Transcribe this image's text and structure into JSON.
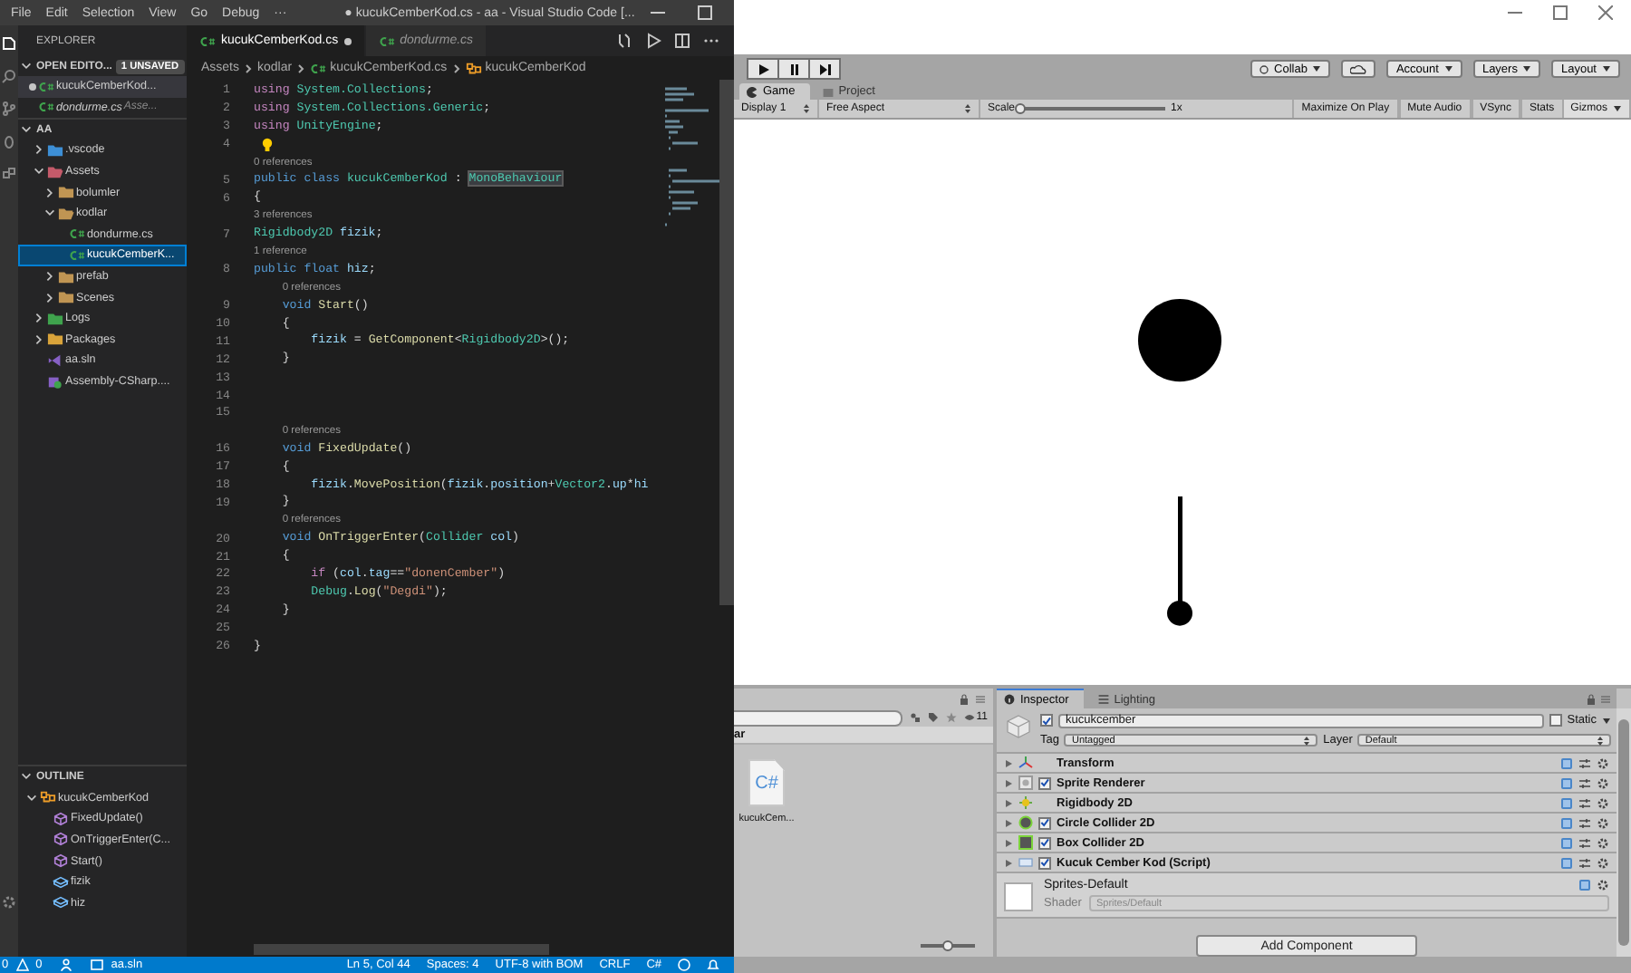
{
  "vscode": {
    "menu": [
      "File",
      "Edit",
      "Selection",
      "View",
      "Go",
      "Debug",
      "···"
    ],
    "title": "● kucukCemberKod.cs - aa - Visual Studio Code [...",
    "explorer": {
      "title": "EXPLORER",
      "open_editors": {
        "label": "OPEN EDITO...",
        "badge": "1 UNSAVED",
        "expanded": true,
        "items": [
          {
            "name": "kucukCemberKod...",
            "kind": "csharp",
            "dirty": true,
            "preview": false,
            "selected": true
          },
          {
            "name": "dondurme.cs",
            "description": "Asse...",
            "kind": "csharp",
            "dirty": false,
            "preview": true,
            "selected": false
          }
        ]
      },
      "folder": {
        "label": "AA",
        "expanded": true,
        "children": [
          {
            "label": ".vscode",
            "kind": "folder",
            "color": "#3d8fd6",
            "expanded": false,
            "selected": false
          },
          {
            "label": "Assets",
            "kind": "folder",
            "color": "#c55a6a",
            "expanded": true,
            "selected": false,
            "children": [
              {
                "label": "bolumler",
                "kind": "folder",
                "color": "#c09553",
                "expanded": false,
                "selected": false
              },
              {
                "label": "kodlar",
                "kind": "folder",
                "color": "#c09553",
                "expanded": true,
                "selected": false,
                "children": [
                  {
                    "label": "dondurme.cs",
                    "kind": "csharp",
                    "selected": false
                  },
                  {
                    "label": "kucukCemberK...",
                    "kind": "csharp",
                    "selected": true
                  }
                ]
              },
              {
                "label": "prefab",
                "kind": "folder",
                "color": "#c09553",
                "expanded": false,
                "selected": false
              },
              {
                "label": "Scenes",
                "kind": "folder",
                "color": "#c09553",
                "expanded": false,
                "selected": false
              }
            ]
          },
          {
            "label": "Logs",
            "kind": "folder",
            "color": "#3fa34d",
            "expanded": false,
            "selected": false
          },
          {
            "label": "Packages",
            "kind": "folder",
            "color": "#d9a33a",
            "expanded": false,
            "selected": false
          },
          {
            "label": "aa.sln",
            "kind": "solution",
            "selected": false
          },
          {
            "label": "Assembly-CSharp....",
            "kind": "project",
            "selected": false
          }
        ]
      },
      "outline": {
        "label": "OUTLINE",
        "expanded": true,
        "children": [
          {
            "label": "kucukCemberKod",
            "kind": "class",
            "expanded": true,
            "children": [
              {
                "label": "FixedUpdate()",
                "kind": "method"
              },
              {
                "label": "OnTriggerEnter(C...",
                "kind": "method"
              },
              {
                "label": "Start()",
                "kind": "method"
              },
              {
                "label": "fizik",
                "kind": "field"
              },
              {
                "label": "hiz",
                "kind": "field"
              }
            ]
          }
        ]
      }
    },
    "tabs": [
      {
        "label": "kucukCemberKod.cs",
        "kind": "csharp",
        "selected": true,
        "dirty": true,
        "preview": false
      },
      {
        "label": "dondurme.cs",
        "kind": "csharp",
        "selected": false,
        "dirty": false,
        "preview": true
      }
    ],
    "breadcrumb": [
      {
        "label": "Assets",
        "kind": "folder"
      },
      {
        "label": "kodlar",
        "kind": "folder"
      },
      {
        "label": "kucukCemberKod.cs",
        "kind": "csharp"
      },
      {
        "label": "kucukCemberKod",
        "kind": "class"
      }
    ],
    "lines": [
      {
        "kind": "code",
        "number": "1",
        "tokens": [
          {
            "kind": "control",
            "text": "using "
          },
          {
            "kind": "type",
            "text": "System.Collections"
          },
          {
            "kind": "plain",
            "text": ";"
          }
        ]
      },
      {
        "kind": "code",
        "number": "2",
        "tokens": [
          {
            "kind": "control",
            "text": "using "
          },
          {
            "kind": "type",
            "text": "System.Collections.Generic"
          },
          {
            "kind": "plain",
            "text": ";"
          }
        ]
      },
      {
        "kind": "code",
        "number": "3",
        "tokens": [
          {
            "kind": "control",
            "text": "using "
          },
          {
            "kind": "type",
            "text": "UnityEngine"
          },
          {
            "kind": "plain",
            "text": ";"
          }
        ]
      },
      {
        "kind": "code",
        "number": "4",
        "lightbulb": true
      },
      {
        "kind": "codelens",
        "text": "0 references"
      },
      {
        "kind": "code",
        "number": "5",
        "tokens": [
          {
            "kind": "keyword",
            "text": "public class "
          },
          {
            "kind": "type",
            "text": "kucukCemberKod"
          },
          {
            "kind": "plain",
            "text": " : "
          },
          {
            "kind": "match",
            "text": "MonoBehaviour"
          }
        ]
      },
      {
        "kind": "code",
        "number": "6",
        "tokens": [
          {
            "kind": "plain",
            "text": "{"
          }
        ]
      },
      {
        "kind": "codelens",
        "text": "3 references"
      },
      {
        "kind": "code",
        "number": "7",
        "tokens": [
          {
            "kind": "type",
            "text": "Rigidbody2D "
          },
          {
            "kind": "var",
            "text": "fizik"
          },
          {
            "kind": "plain",
            "text": ";"
          }
        ]
      },
      {
        "kind": "codelens",
        "text": "1 reference"
      },
      {
        "kind": "code",
        "number": "8",
        "tokens": [
          {
            "kind": "keyword",
            "text": "public float "
          },
          {
            "kind": "var",
            "text": "hiz"
          },
          {
            "kind": "plain",
            "text": ";"
          }
        ]
      },
      {
        "kind": "codelens",
        "text": "0 references"
      },
      {
        "kind": "code",
        "number": "9",
        "tokens": [
          {
            "kind": "keyword",
            "text": "    void "
          },
          {
            "kind": "func",
            "text": "Start"
          },
          {
            "kind": "plain",
            "text": "()"
          }
        ]
      },
      {
        "kind": "code",
        "number": "10",
        "tokens": [
          {
            "kind": "plain",
            "text": "    {"
          }
        ]
      },
      {
        "kind": "code",
        "number": "11",
        "tokens": [
          {
            "kind": "var",
            "text": "        fizik"
          },
          {
            "kind": "plain",
            "text": " = "
          },
          {
            "kind": "func",
            "text": "GetComponent"
          },
          {
            "kind": "plain",
            "text": "<"
          },
          {
            "kind": "type",
            "text": "Rigidbody2D"
          },
          {
            "kind": "plain",
            "text": ">();"
          }
        ]
      },
      {
        "kind": "code",
        "number": "12",
        "tokens": [
          {
            "kind": "plain",
            "text": "    }"
          }
        ]
      },
      {
        "kind": "code",
        "number": "13"
      },
      {
        "kind": "code",
        "number": "14"
      },
      {
        "kind": "code",
        "number": "15"
      },
      {
        "kind": "codelens",
        "text": "0 references"
      },
      {
        "kind": "code",
        "number": "16",
        "tokens": [
          {
            "kind": "keyword",
            "text": "    void "
          },
          {
            "kind": "func",
            "text": "FixedUpdate"
          },
          {
            "kind": "plain",
            "text": "()"
          }
        ]
      },
      {
        "kind": "code",
        "number": "17",
        "tokens": [
          {
            "kind": "plain",
            "text": "    {"
          }
        ]
      },
      {
        "kind": "code",
        "number": "18",
        "tokens": [
          {
            "kind": "var",
            "text": "        fizik"
          },
          {
            "kind": "plain",
            "text": "."
          },
          {
            "kind": "func",
            "text": "MovePosition"
          },
          {
            "kind": "plain",
            "text": "("
          },
          {
            "kind": "var",
            "text": "fizik"
          },
          {
            "kind": "plain",
            "text": "."
          },
          {
            "kind": "var",
            "text": "position"
          },
          {
            "kind": "plain",
            "text": "+"
          },
          {
            "kind": "type",
            "text": "Vector2"
          },
          {
            "kind": "plain",
            "text": "."
          },
          {
            "kind": "var",
            "text": "up"
          },
          {
            "kind": "plain",
            "text": "*"
          },
          {
            "kind": "var",
            "text": "hi"
          }
        ]
      },
      {
        "kind": "code",
        "number": "19",
        "tokens": [
          {
            "kind": "plain",
            "text": "    }"
          }
        ]
      },
      {
        "kind": "codelens",
        "text": "0 references"
      },
      {
        "kind": "code",
        "number": "20",
        "tokens": [
          {
            "kind": "keyword",
            "text": "    void "
          },
          {
            "kind": "func",
            "text": "OnTriggerEnter"
          },
          {
            "kind": "plain",
            "text": "("
          },
          {
            "kind": "type",
            "text": "Collider "
          },
          {
            "kind": "var",
            "text": "col"
          },
          {
            "kind": "plain",
            "text": ")"
          }
        ]
      },
      {
        "kind": "code",
        "number": "21",
        "tokens": [
          {
            "kind": "plain",
            "text": "    {"
          }
        ]
      },
      {
        "kind": "code",
        "number": "22",
        "tokens": [
          {
            "kind": "control",
            "text": "        if"
          },
          {
            "kind": "plain",
            "text": " ("
          },
          {
            "kind": "var",
            "text": "col"
          },
          {
            "kind": "plain",
            "text": "."
          },
          {
            "kind": "var",
            "text": "tag"
          },
          {
            "kind": "plain",
            "text": "=="
          },
          {
            "kind": "string",
            "text": "\"donenCember\""
          },
          {
            "kind": "plain",
            "text": ")"
          }
        ]
      },
      {
        "kind": "code",
        "number": "23",
        "tokens": [
          {
            "kind": "type",
            "text": "        Debug"
          },
          {
            "kind": "plain",
            "text": "."
          },
          {
            "kind": "func",
            "text": "Log"
          },
          {
            "kind": "plain",
            "text": "("
          },
          {
            "kind": "string",
            "text": "\"Degdi\""
          },
          {
            "kind": "plain",
            "text": ");"
          }
        ]
      },
      {
        "kind": "code",
        "number": "24",
        "tokens": [
          {
            "kind": "plain",
            "text": "    }"
          }
        ]
      },
      {
        "kind": "code",
        "number": "25"
      },
      {
        "kind": "code",
        "number": "26",
        "tokens": [
          {
            "kind": "plain",
            "text": "}"
          }
        ]
      }
    ],
    "status_bar": {
      "errors": "0",
      "warnings": "0",
      "solution": "aa.sln",
      "position": "Ln 5, Col 44",
      "spaces": "Spaces: 4",
      "encoding": "UTF-8 with BOM",
      "eol": "CRLF",
      "language": "C#"
    }
  },
  "unity": {
    "toolbar": {
      "transport": [
        {
          "kind": "play"
        },
        {
          "kind": "pause"
        },
        {
          "kind": "step"
        }
      ],
      "collab": "Collab",
      "dropdowns": [
        "Account",
        "Layers",
        "Layout"
      ]
    },
    "tabs": [
      {
        "label": "Game",
        "kind": "game",
        "selected": true
      },
      {
        "label": "Project",
        "kind": "project",
        "selected": false
      }
    ],
    "game_bar": {
      "display": "Display 1",
      "aspect": "Free Aspect",
      "scale": {
        "label": "Scale",
        "level": 0,
        "reading": "1x"
      },
      "toggles": [
        {
          "label": "Maximize On Play",
          "on": false
        },
        {
          "label": "Mute Audio",
          "on": false
        },
        {
          "label": "VSync",
          "on": false
        },
        {
          "label": "Stats",
          "on": false
        }
      ],
      "gizmos": "Gizmos"
    },
    "project": {
      "count": "11",
      "folder": "ar",
      "files": [
        {
          "name": "kucukCem...",
          "kind": "script",
          "icon_text": "C#"
        }
      ],
      "size_slider": {
        "level": 0.5
      }
    },
    "inspector": {
      "tabs": [
        {
          "label": "Inspector",
          "kind": "info",
          "selected": true
        },
        {
          "label": "Lighting",
          "kind": "lighting",
          "selected": false
        }
      ],
      "object": {
        "active": true,
        "name": "kucukcember",
        "static": {
          "label": "Static",
          "checked": false
        },
        "tag": {
          "label": "Tag",
          "value": "Untagged"
        },
        "layer": {
          "label": "Layer",
          "value": "Default"
        }
      },
      "components": [
        {
          "name": "Transform",
          "kind": "transform"
        },
        {
          "name": "Sprite Renderer",
          "kind": "sprite",
          "checked": true
        },
        {
          "name": "Rigidbody 2D",
          "kind": "rigidbody"
        },
        {
          "name": "Circle Collider 2D",
          "kind": "circle-collider",
          "checked": true
        },
        {
          "name": "Box Collider 2D",
          "kind": "box-collider",
          "checked": true
        },
        {
          "name": "Kucuk Cember Kod (Script)",
          "kind": "script",
          "checked": true
        }
      ],
      "material": {
        "name": "Sprites-Default",
        "shader_label": "Shader",
        "shader": "Sprites/Default"
      },
      "add_component": "Add Component"
    }
  }
}
